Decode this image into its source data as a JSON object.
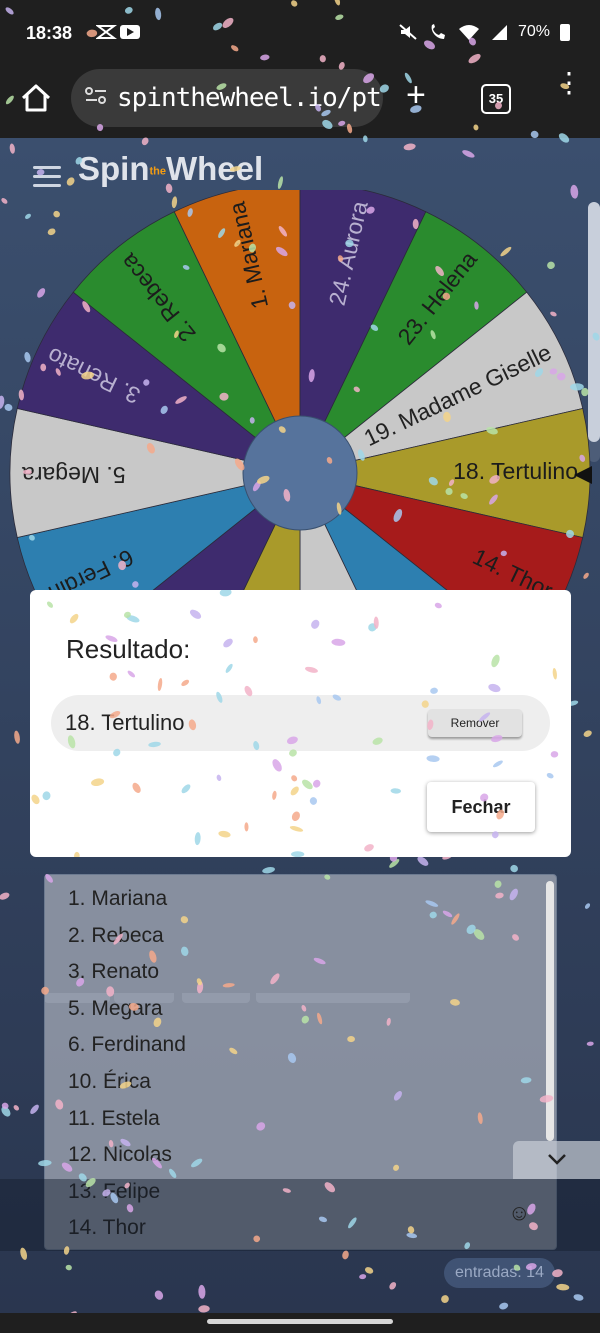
{
  "status_bar": {
    "time": "18:38",
    "battery": "70%"
  },
  "browser": {
    "url": "spinthewheel.io/pt",
    "tab_count": "35"
  },
  "site": {
    "logo_left": "Spin",
    "logo_the": "the",
    "logo_right": "Wheel"
  },
  "wheel": {
    "selected": "18. Tertulino",
    "colors": {
      "orange": "#c8630f",
      "purple": "#3e2b6e",
      "green": "#2a8b2e",
      "gray": "#c8c8c8",
      "olive": "#a99a2a",
      "red": "#a61b1b",
      "blue": "#2d7fb0",
      "hub": "#56739c"
    },
    "segments": [
      {
        "label": "1. Mariana",
        "color": "orange"
      },
      {
        "label": "24. Aurora",
        "color": "purple"
      },
      {
        "label": "23. Helena",
        "color": "green"
      },
      {
        "label": "19. Madame Giselle",
        "color": "gray"
      },
      {
        "label": "18. Tertulino",
        "color": "olive"
      },
      {
        "label": "14. Thor",
        "color": "red"
      },
      {
        "label": "",
        "color": "blue"
      },
      {
        "label": "",
        "color": "gray"
      },
      {
        "label": "",
        "color": "olive"
      },
      {
        "label": "",
        "color": "purple"
      },
      {
        "label": "6. Ferdin",
        "color": "blue"
      },
      {
        "label": "5. Megara",
        "color": "gray"
      },
      {
        "label": "3. Renato",
        "color": "purple"
      },
      {
        "label": "2. Rebeca",
        "color": "green"
      }
    ]
  },
  "modal": {
    "title": "Resultado:",
    "result": "18. Tertulino",
    "remove_label": "Remover",
    "close_label": "Fechar"
  },
  "entries": [
    "1. Mariana",
    "2. Rebeca",
    "3. Renato",
    "5. Megara",
    "6. Ferdinand",
    "10. Érica",
    "11. Estela",
    "12. Nicolas",
    "13. Felipe",
    "14. Thor"
  ],
  "counter": "entradas: 14"
}
